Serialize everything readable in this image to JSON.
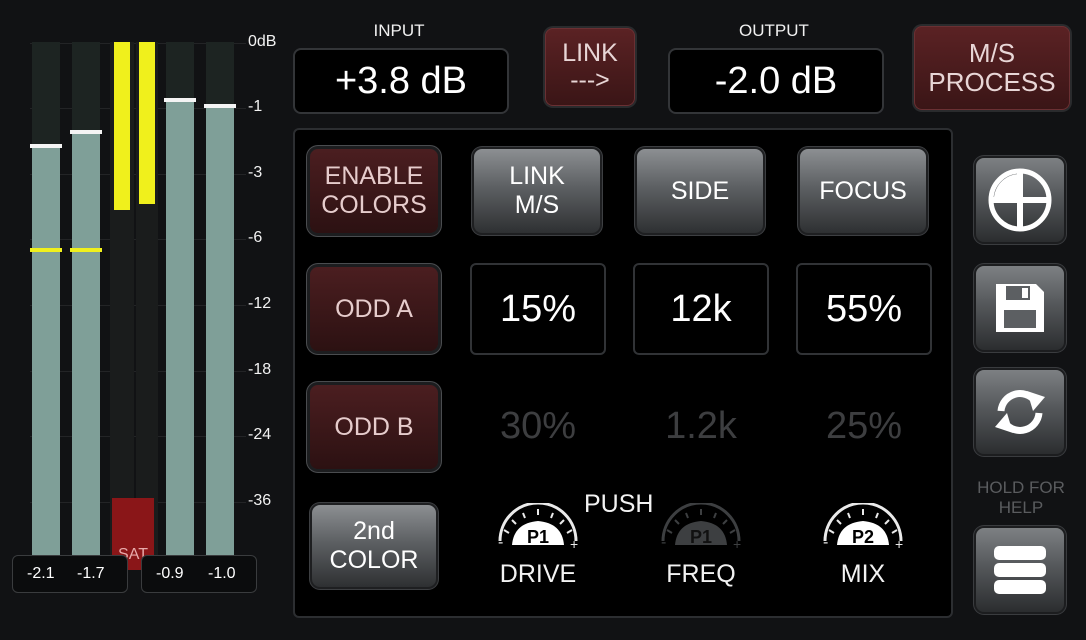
{
  "meters": {
    "scale": [
      "0dB",
      "-1",
      "-3",
      "-6",
      "-12",
      "-18",
      "-24",
      "-36"
    ],
    "input_readouts": [
      "-2.1",
      "-1.7"
    ],
    "output_readouts": [
      "-0.9",
      "-1.0"
    ],
    "saturation_label": "SAT",
    "input_peak_marker": "-6"
  },
  "input": {
    "label": "INPUT",
    "value": "+3.8 dB"
  },
  "link_button": {
    "line1": "LINK",
    "line2": "--->"
  },
  "output": {
    "label": "OUTPUT",
    "value": "-2.0 dB"
  },
  "ms_button": {
    "line1": "M/S",
    "line2": "PROCESS"
  },
  "buttons": {
    "enable_colors": {
      "line1": "ENABLE",
      "line2": "COLORS"
    },
    "link_ms": {
      "line1": "LINK",
      "line2": "M/S"
    },
    "side": "SIDE",
    "focus": "FOCUS",
    "odd_a": "ODD A",
    "odd_b": "ODD B",
    "second_color": {
      "line1": "2nd",
      "line2": "COLOR"
    }
  },
  "row_a": [
    "15%",
    "12k",
    "55%"
  ],
  "row_b": [
    "30%",
    "1.2k",
    "25%"
  ],
  "push_label": "PUSH",
  "knobs": [
    {
      "tag": "P1",
      "label": "DRIVE",
      "active": true
    },
    {
      "tag": "P1",
      "label": "FREQ",
      "active": false
    },
    {
      "tag": "P2",
      "label": "MIX",
      "active": true
    }
  ],
  "help_text": {
    "line1": "HOLD FOR",
    "line2": "HELP"
  },
  "colors": {
    "meter_fill": "#7f9f98",
    "gain_reduction": "#f0f01c",
    "saturation": "#8a1618",
    "red_button": "#4b1e20"
  }
}
